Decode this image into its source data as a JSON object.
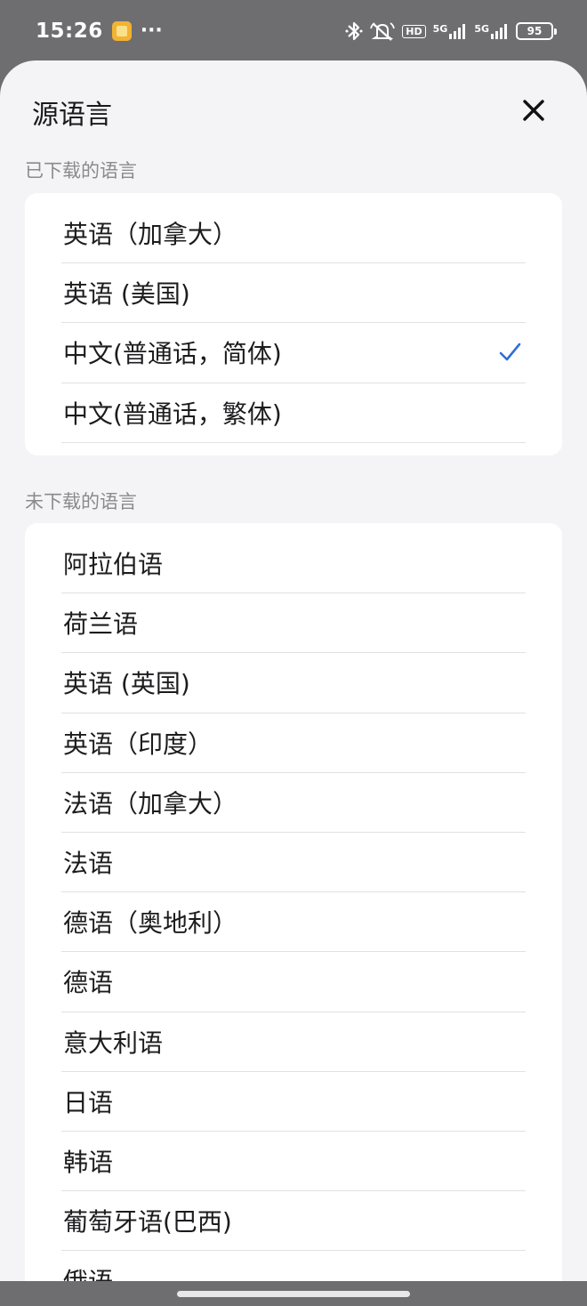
{
  "status_bar": {
    "time": "15:26",
    "more": "···",
    "hd_label": "HD",
    "net1": "5G",
    "net2": "5G",
    "battery": "95",
    "icons": [
      "app-notification-icon",
      "bluetooth-icon",
      "silent-icon",
      "signal-icon",
      "signal-icon",
      "battery-icon"
    ]
  },
  "sheet": {
    "title": "源语言",
    "close_icon": "close-icon"
  },
  "downloaded": {
    "label": "已下载的语言",
    "items": [
      {
        "label": "英语（加拿大）",
        "selected": false
      },
      {
        "label": "英语 (美国)",
        "selected": false
      },
      {
        "label": "中文(普通话，简体)",
        "selected": true
      },
      {
        "label": "中文(普通话，繁体)",
        "selected": false
      }
    ]
  },
  "not_downloaded": {
    "label": "未下载的语言",
    "items": [
      {
        "label": "阿拉伯语"
      },
      {
        "label": "荷兰语"
      },
      {
        "label": "英语 (英国)"
      },
      {
        "label": "英语（印度）"
      },
      {
        "label": "法语（加拿大）"
      },
      {
        "label": "法语"
      },
      {
        "label": "德语（奥地利）"
      },
      {
        "label": "德语"
      },
      {
        "label": "意大利语"
      },
      {
        "label": "日语"
      },
      {
        "label": "韩语"
      },
      {
        "label": "葡萄牙语(巴西)"
      },
      {
        "label": "俄语"
      }
    ]
  },
  "colors": {
    "accent": "#2f6fd6",
    "sheet_bg": "#f4f4f6",
    "card_bg": "#ffffff"
  }
}
